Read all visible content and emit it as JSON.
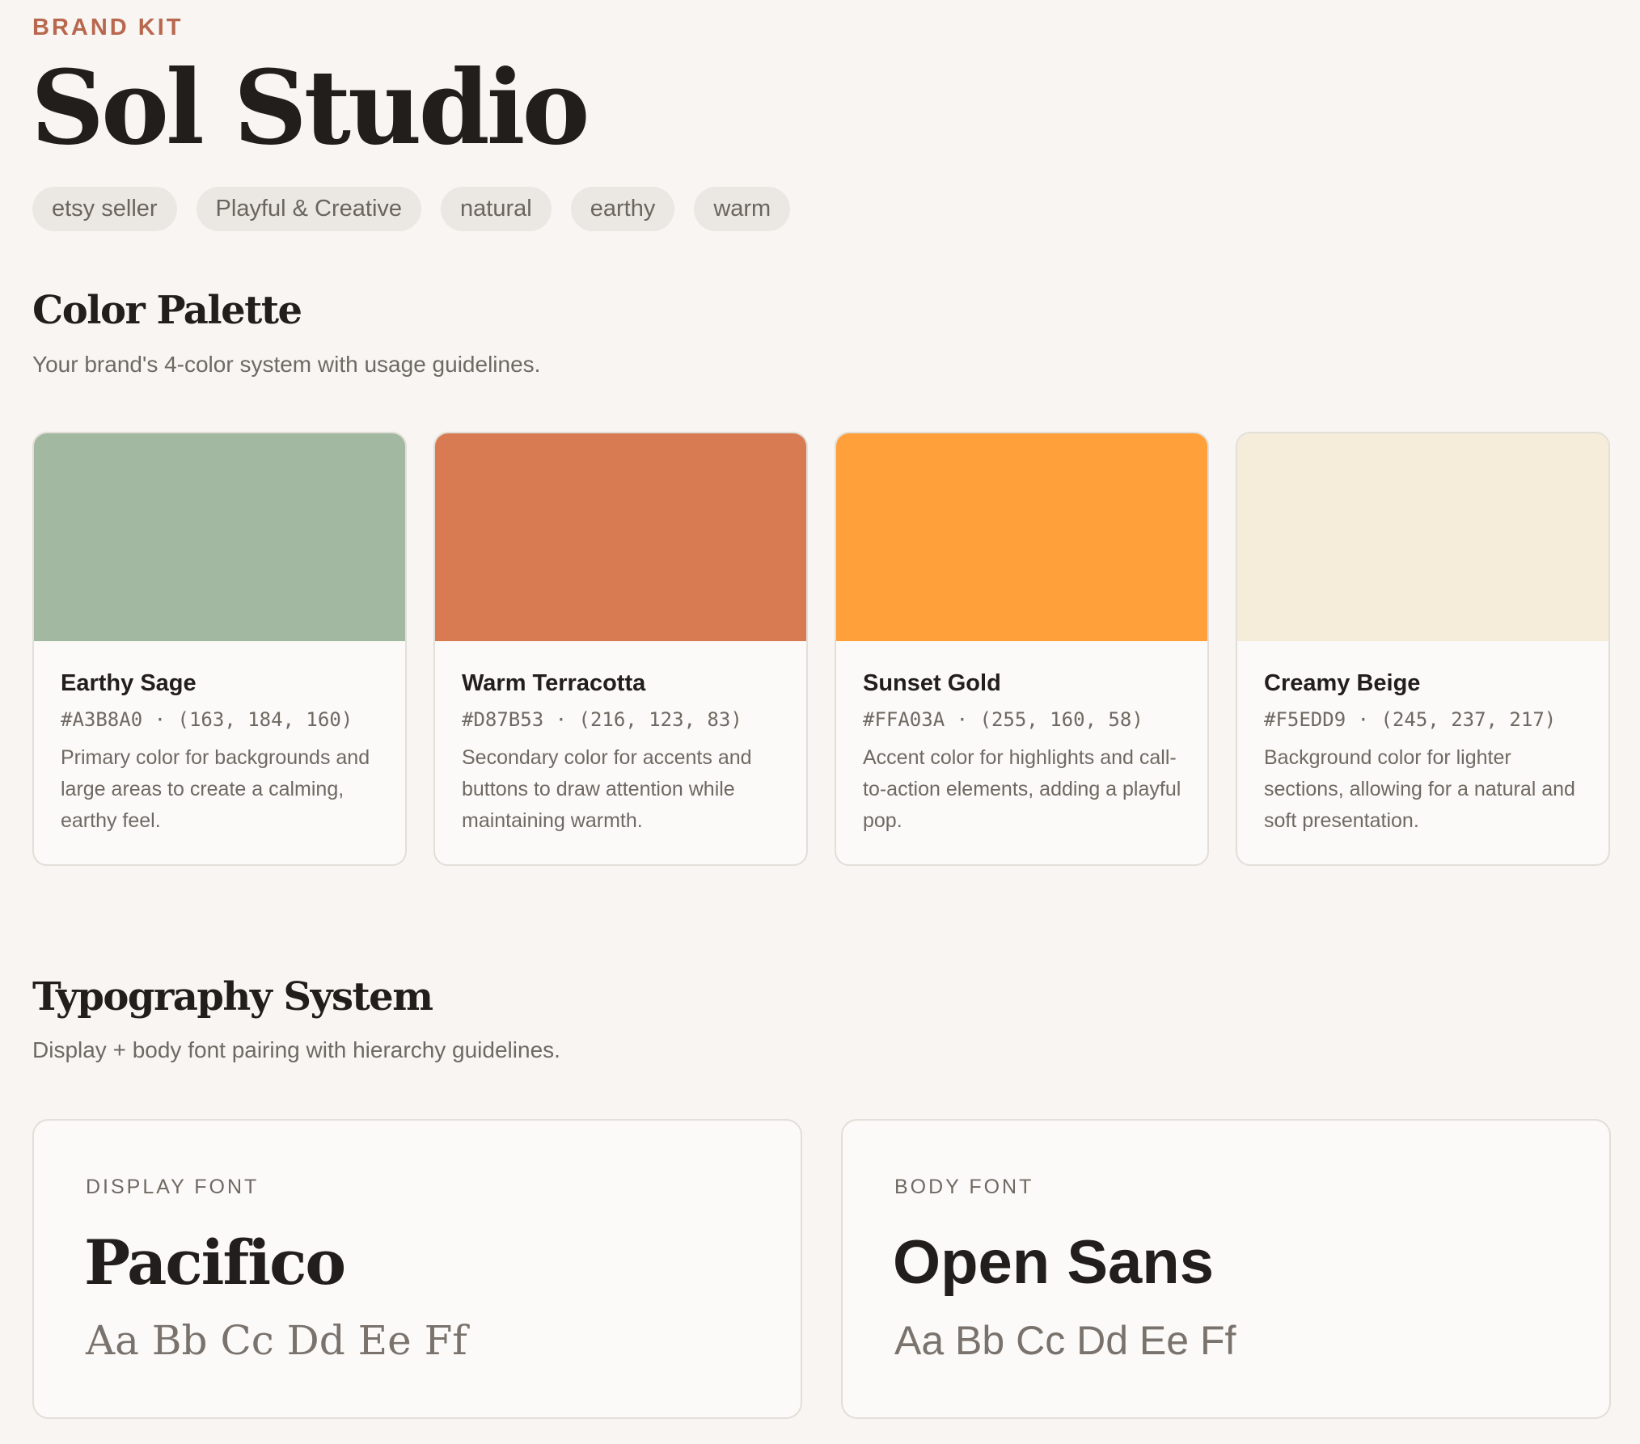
{
  "header": {
    "eyebrow": "BRAND KIT",
    "title": "Sol Studio",
    "tags": [
      "etsy seller",
      "Playful & Creative",
      "natural",
      "earthy",
      "warm"
    ]
  },
  "palette": {
    "title": "Color Palette",
    "subtitle": "Your brand's 4-color system with usage guidelines.",
    "colors": [
      {
        "name": "Earthy Sage",
        "hex": "#A3B8A0",
        "codes": "#A3B8A0 · (163, 184, 160)",
        "description": "Primary color for backgrounds and large areas to create a calming, earthy feel."
      },
      {
        "name": "Warm Terracotta",
        "hex": "#D87B53",
        "codes": "#D87B53 · (216, 123, 83)",
        "description": "Secondary color for accents and buttons to draw attention while maintaining warmth."
      },
      {
        "name": "Sunset Gold",
        "hex": "#FFA03A",
        "codes": "#FFA03A · (255, 160, 58)",
        "description": "Accent color for highlights and call-to-action elements, adding a playful pop."
      },
      {
        "name": "Creamy Beige",
        "hex": "#F5EDD9",
        "codes": "#F5EDD9 · (245, 237, 217)",
        "description": "Background color for lighter sections, allowing for a natural and soft presentation."
      }
    ]
  },
  "typography": {
    "title": "Typography System",
    "subtitle": "Display + body font pairing with hierarchy guidelines.",
    "display": {
      "label": "DISPLAY FONT",
      "name": "Pacifico",
      "sample": "Aa Bb Cc Dd Ee Ff"
    },
    "body": {
      "label": "BODY FONT",
      "name": "Open Sans",
      "sample": "Aa Bb Cc Dd Ee Ff"
    }
  },
  "theme": {
    "accent": "#B8684E",
    "background": "#F8F5F2",
    "text": "#211E1B",
    "muted": "#6F6963"
  }
}
